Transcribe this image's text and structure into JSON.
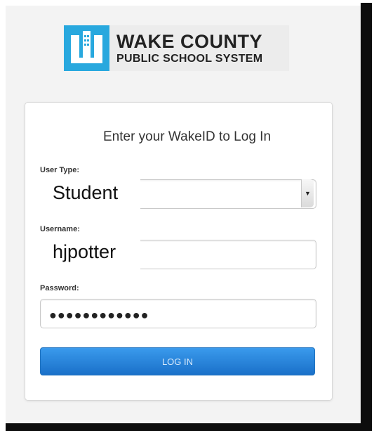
{
  "logo": {
    "line1": "WAKE COUNTY",
    "line2": "PUBLIC SCHOOL SYSTEM"
  },
  "form": {
    "title": "Enter your WakeID to Log In",
    "user_type": {
      "label": "User Type:",
      "value": "Student"
    },
    "username": {
      "label": "Username:",
      "value": "hjpotter"
    },
    "password": {
      "label": "Password:",
      "masked_value": "●●●●●●●●●●●●"
    },
    "submit_label": "LOG IN"
  },
  "colors": {
    "brand_blue": "#28a8de",
    "button_blue": "#1a70c9"
  }
}
